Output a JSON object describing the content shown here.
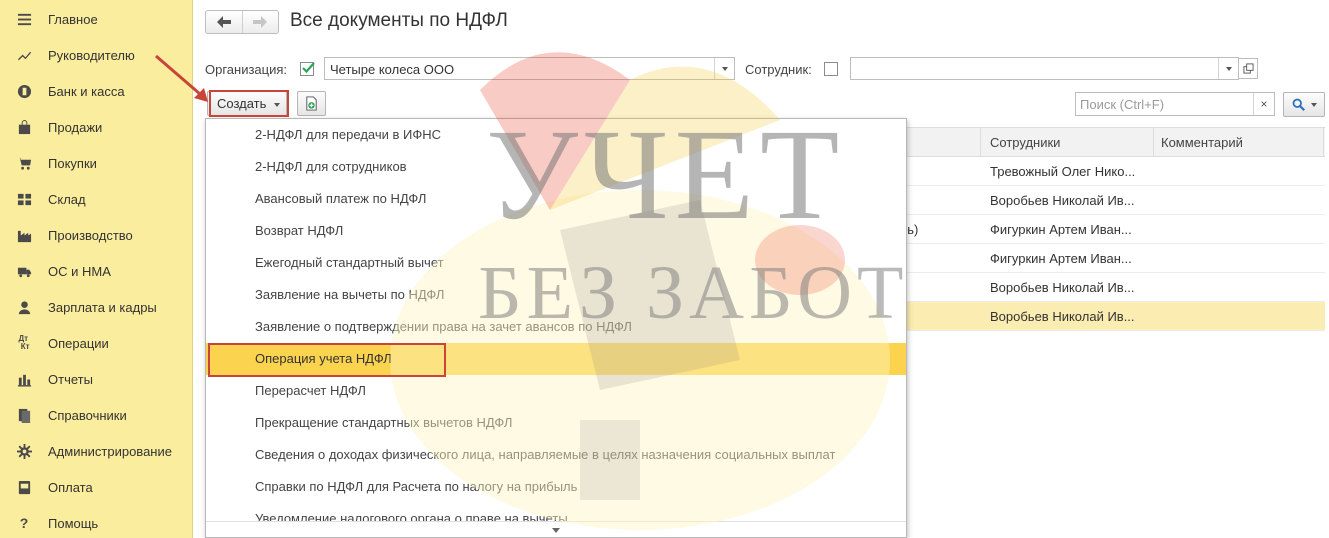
{
  "sidebar": {
    "items": [
      {
        "label": "Главное",
        "icon": "menu-icon"
      },
      {
        "label": "Руководителю",
        "icon": "trend-icon"
      },
      {
        "label": "Банк и касса",
        "icon": "coin-icon"
      },
      {
        "label": "Продажи",
        "icon": "bag-icon"
      },
      {
        "label": "Покупки",
        "icon": "cart-icon"
      },
      {
        "label": "Склад",
        "icon": "warehouse-icon"
      },
      {
        "label": "Производство",
        "icon": "factory-icon"
      },
      {
        "label": "ОС и НМА",
        "icon": "truck-icon"
      },
      {
        "label": "Зарплата и кадры",
        "icon": "person-icon"
      },
      {
        "label": "Операции",
        "icon": "dt-kt-icon"
      },
      {
        "label": "Отчеты",
        "icon": "bar-chart-icon"
      },
      {
        "label": "Справочники",
        "icon": "books-icon"
      },
      {
        "label": "Администрирование",
        "icon": "gear-icon"
      },
      {
        "label": "Оплата",
        "icon": "payment-icon"
      },
      {
        "label": "Помощь",
        "icon": "question-icon"
      }
    ]
  },
  "header": {
    "title": "Все документы по НДФЛ"
  },
  "filters": {
    "org_label": "Организация:",
    "org_value": "Четыре колеса ООО",
    "org_checked": true,
    "employee_label": "Сотрудник:",
    "employee_checked": false,
    "employee_value": ""
  },
  "toolbar": {
    "create_label": "Создать",
    "search_placeholder": "Поиск (Ctrl+F)",
    "clear_label": "×"
  },
  "table": {
    "columns": [
      "Сотрудники",
      "Комментарий"
    ],
    "rows": [
      {
        "extra": "",
        "employee": "Тревожный Олег Нико...",
        "comment": ""
      },
      {
        "extra": "",
        "employee": "Воробьев Николай Ив...",
        "comment": ""
      },
      {
        "extra": "варь)",
        "employee": "Фигуркин Артем Иван...",
        "comment": ""
      },
      {
        "extra": "",
        "employee": "Фигуркин Артем Иван...",
        "comment": ""
      },
      {
        "extra": "",
        "employee": "Воробьев Николай Ив...",
        "comment": ""
      },
      {
        "extra": "",
        "employee": "Воробьев Николай Ив...",
        "comment": ""
      }
    ]
  },
  "menu": {
    "items": [
      "2-НДФЛ для передачи в ИФНС",
      "2-НДФЛ для сотрудников",
      "Авансовый платеж по НДФЛ",
      "Возврат НДФЛ",
      "Ежегодный стандартный вычет",
      "Заявление на вычеты по НДФЛ",
      "Заявление о подтверждении права на зачет авансов по НДФЛ",
      "Операция учета НДФЛ",
      "Перерасчет НДФЛ",
      "Прекращение стандартных вычетов НДФЛ",
      "Сведения о доходах физического лица, направляемые в целях назначения социальных выплат",
      "Справки по НДФЛ для Расчета по налогу на прибыль",
      "Уведомление налогового органа о праве на вычеты"
    ],
    "highlighted_index": 7
  },
  "watermark": {
    "line1": "УЧЕТ",
    "line2": "БЕЗ ЗАБОТ"
  },
  "colors": {
    "sidebar_bg": "#fbed9e",
    "highlight": "#fbd34f",
    "selected_row": "#fbedb1",
    "annotation": "#c9453a",
    "check": "#2aa55a"
  }
}
